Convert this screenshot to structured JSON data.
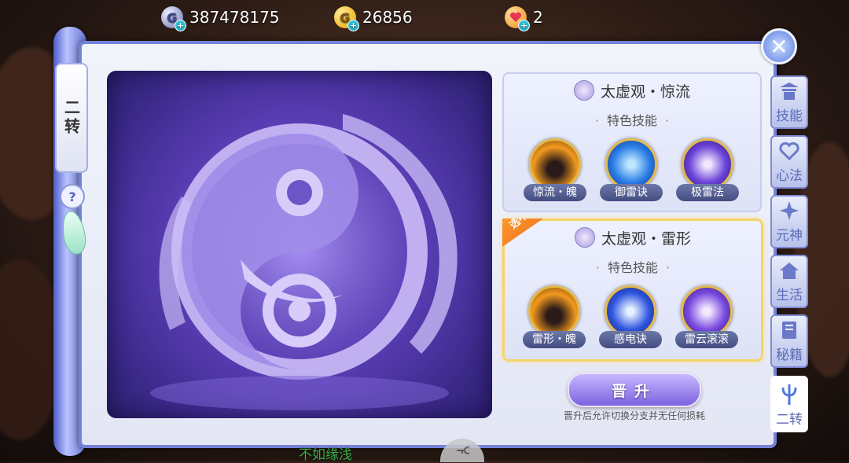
{
  "currency": {
    "silver": {
      "icon": "silver-g-coin-icon",
      "value": "387478175"
    },
    "gold": {
      "icon": "gold-g-coin-icon",
      "value": "26856"
    },
    "heart": {
      "icon": "heart-token-icon",
      "value": "2"
    }
  },
  "left_tag": "二转",
  "help_symbol": "?",
  "close_symbol": "✕",
  "branches": [
    {
      "title": "太虚观・惊流",
      "subtitle": "特色技能",
      "selected": false,
      "skills": [
        {
          "label": "惊流・魄",
          "icon": "flame-cat-icon",
          "color": "#f39a1d"
        },
        {
          "label": "御雷诀",
          "icon": "lightning-swirl-icon",
          "color": "#2a7de8"
        },
        {
          "label": "极雷法",
          "icon": "thunder-hand-icon",
          "color": "#6b43d8"
        }
      ]
    },
    {
      "title": "太虚观・雷形",
      "subtitle": "特色技能",
      "selected": true,
      "selected_label": "选中",
      "skills": [
        {
          "label": "雷形・魄",
          "icon": "flame-cat-icon",
          "color": "#f39a1d"
        },
        {
          "label": "感电诀",
          "icon": "electric-burst-icon",
          "color": "#3157e0"
        },
        {
          "label": "雷云滚滚",
          "icon": "thunder-cloud-icon",
          "color": "#7b4be0"
        }
      ]
    }
  ],
  "advance_button": "晋升",
  "advance_note": "晋升后允许切换分支并无任何损耗",
  "tabs": [
    {
      "label": "技能",
      "icon": "pagoda-icon",
      "active": false
    },
    {
      "label": "心法",
      "icon": "heart-hand-icon",
      "active": false
    },
    {
      "label": "元神",
      "icon": "shuriken-icon",
      "active": false
    },
    {
      "label": "生活",
      "icon": "house-icon",
      "active": false
    },
    {
      "label": "秘籍",
      "icon": "book-icon",
      "active": false
    },
    {
      "label": "二转",
      "icon": "trident-icon",
      "active": true
    }
  ],
  "bottom_text": "不如缘浅",
  "emblem": {
    "icon": "taixu-yinyang-emblem-icon"
  }
}
